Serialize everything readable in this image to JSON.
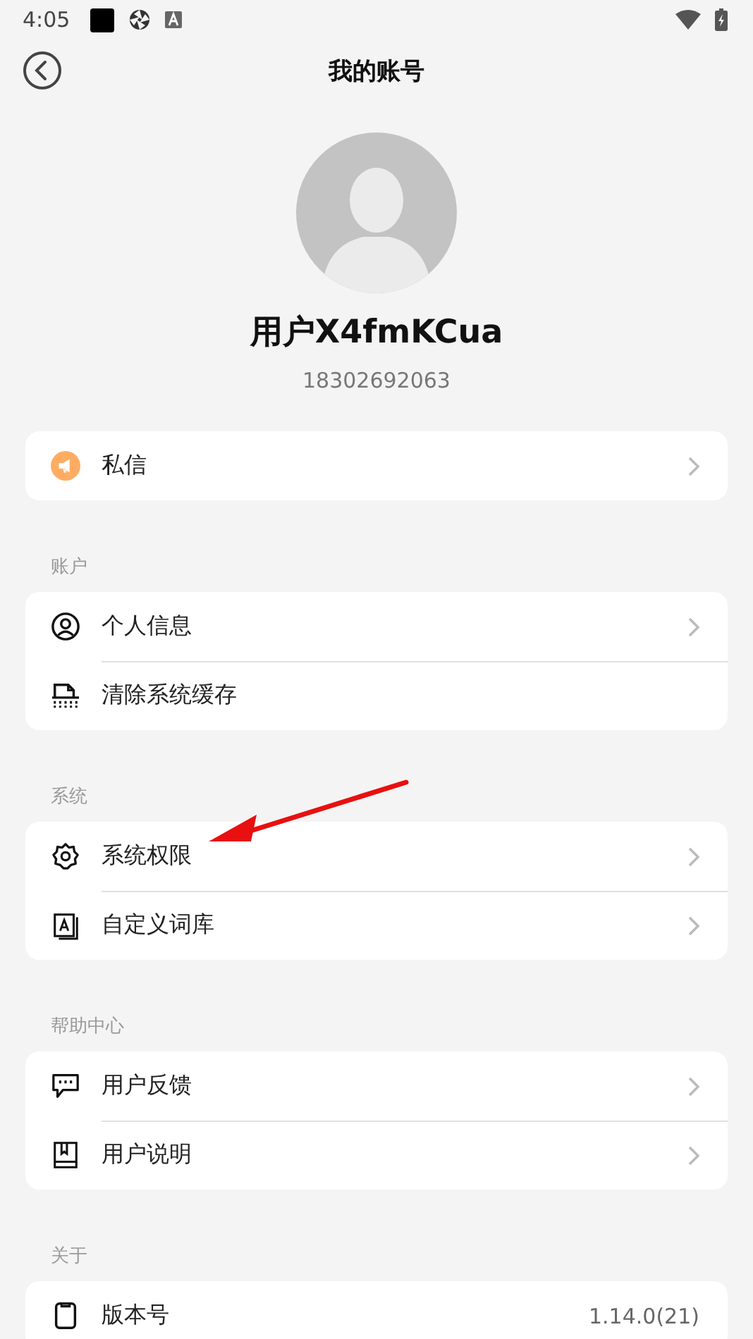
{
  "status_bar": {
    "time": "4:05"
  },
  "header": {
    "title": "我的账号"
  },
  "profile": {
    "name": "用户X4fmKCua",
    "phone": "18302692063"
  },
  "sections": [
    {
      "items": [
        {
          "kind": "megaphone",
          "label": "私信",
          "chevron": true
        }
      ]
    },
    {
      "label": "账户",
      "items": [
        {
          "kind": "person",
          "label": "个人信息",
          "chevron": true
        },
        {
          "kind": "shredder",
          "label": "清除系统缓存",
          "chevron": false
        }
      ]
    },
    {
      "label": "系统",
      "items": [
        {
          "kind": "gear",
          "label": "系统权限",
          "chevron": true
        },
        {
          "kind": "dictionary",
          "label": "自定义词库",
          "chevron": true
        }
      ]
    },
    {
      "label": "帮助中心",
      "items": [
        {
          "kind": "feedback",
          "label": "用户反馈",
          "chevron": true
        },
        {
          "kind": "book",
          "label": "用户说明",
          "chevron": true
        }
      ]
    },
    {
      "label": "关于",
      "items": [
        {
          "kind": "phone",
          "label": "版本号",
          "chevron": false,
          "value": "1.14.0(21)"
        }
      ]
    }
  ]
}
